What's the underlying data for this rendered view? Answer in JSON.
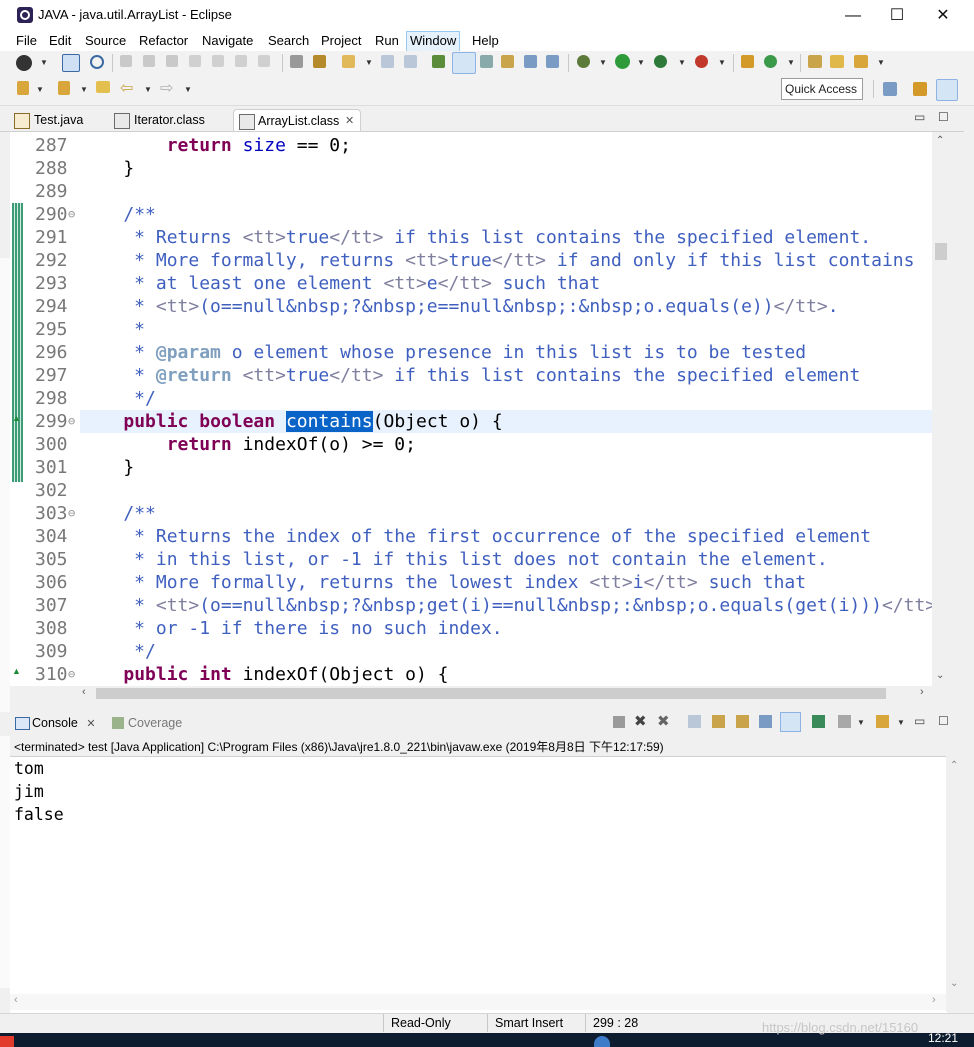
{
  "window": {
    "title": "JAVA - java.util.ArrayList - Eclipse",
    "minimize": "—",
    "maximize": "☐",
    "close": "✕"
  },
  "menu": [
    "File",
    "Edit",
    "Source",
    "Refactor",
    "Navigate",
    "Search",
    "Project",
    "Run",
    "Window",
    "Help"
  ],
  "toolbar": {
    "quick_access": "Quick Access"
  },
  "editor_tabs": [
    {
      "label": "Test.java"
    },
    {
      "label": "Iterator.class"
    },
    {
      "label": "ArrayList.class",
      "active": true,
      "close": "✕"
    }
  ],
  "editor": {
    "lines": [
      {
        "n": "287",
        "code": [
          [
            "        ",
            ""
          ],
          [
            "return",
            "kw"
          ],
          [
            " ",
            ""
          ],
          [
            "size",
            "fld"
          ],
          [
            " == 0;",
            ""
          ]
        ]
      },
      {
        "n": "288",
        "code": [
          [
            "    }",
            ""
          ]
        ]
      },
      {
        "n": "289",
        "code": []
      },
      {
        "n": "290",
        "fold": "⊖",
        "code": [
          [
            "    ",
            ""
          ],
          [
            "/**",
            "cm"
          ]
        ]
      },
      {
        "n": "291",
        "code": [
          [
            "     * Returns ",
            "cm"
          ],
          [
            "<tt>",
            "tag"
          ],
          [
            "true",
            "cm"
          ],
          [
            "</tt>",
            "tag"
          ],
          [
            " if this list contains the specified element.",
            "cm"
          ]
        ]
      },
      {
        "n": "292",
        "code": [
          [
            "     * More formally, returns ",
            "cm"
          ],
          [
            "<tt>",
            "tag"
          ],
          [
            "true",
            "cm"
          ],
          [
            "</tt>",
            "tag"
          ],
          [
            " if and only if this list contains",
            "cm"
          ]
        ]
      },
      {
        "n": "293",
        "code": [
          [
            "     * at least one element ",
            "cm"
          ],
          [
            "<tt>",
            "tag"
          ],
          [
            "e",
            "cm"
          ],
          [
            "</tt>",
            "tag"
          ],
          [
            " such that",
            "cm"
          ]
        ]
      },
      {
        "n": "294",
        "code": [
          [
            "     * ",
            "cm"
          ],
          [
            "<tt>",
            "tag"
          ],
          [
            "(o==null&nbsp;?&nbsp;e==null&nbsp;:&nbsp;o.equals(e))",
            "cm"
          ],
          [
            "</tt>",
            "tag"
          ],
          [
            ".",
            "cm"
          ]
        ]
      },
      {
        "n": "295",
        "code": [
          [
            "     *",
            "cm"
          ]
        ]
      },
      {
        "n": "296",
        "code": [
          [
            "     * ",
            "cm"
          ],
          [
            "@param",
            "jdt"
          ],
          [
            " o element whose presence in this list is to be tested",
            "cm"
          ]
        ]
      },
      {
        "n": "297",
        "code": [
          [
            "     * ",
            "cm"
          ],
          [
            "@return",
            "jdt"
          ],
          [
            " ",
            "cm"
          ],
          [
            "<tt>",
            "tag"
          ],
          [
            "true",
            "cm"
          ],
          [
            "</tt>",
            "tag"
          ],
          [
            " if this list contains the specified element",
            "cm"
          ]
        ]
      },
      {
        "n": "298",
        "code": [
          [
            "     */",
            "cm"
          ]
        ]
      },
      {
        "n": "299",
        "fold": "⊖",
        "code": [
          [
            "    ",
            ""
          ],
          [
            "public",
            "kw"
          ],
          [
            " ",
            ""
          ],
          [
            "boolean",
            "kw"
          ],
          [
            " ",
            ""
          ],
          [
            "contains",
            "sel"
          ],
          [
            "(Object o) {",
            ""
          ]
        ]
      },
      {
        "n": "300",
        "code": [
          [
            "        ",
            ""
          ],
          [
            "return",
            "kw"
          ],
          [
            " indexOf(o) >= 0;",
            ""
          ]
        ]
      },
      {
        "n": "301",
        "code": [
          [
            "    }",
            ""
          ]
        ]
      },
      {
        "n": "302",
        "code": []
      },
      {
        "n": "303",
        "fold": "⊖",
        "code": [
          [
            "    ",
            ""
          ],
          [
            "/**",
            "cm"
          ]
        ]
      },
      {
        "n": "304",
        "code": [
          [
            "     * Returns the index of the first occurrence of the specified element",
            "cm"
          ]
        ]
      },
      {
        "n": "305",
        "code": [
          [
            "     * in this list, or -1 if this list does not contain the element.",
            "cm"
          ]
        ]
      },
      {
        "n": "306",
        "code": [
          [
            "     * More formally, returns the lowest index ",
            "cm"
          ],
          [
            "<tt>",
            "tag"
          ],
          [
            "i",
            "cm"
          ],
          [
            "</tt>",
            "tag"
          ],
          [
            " such that",
            "cm"
          ]
        ]
      },
      {
        "n": "307",
        "code": [
          [
            "     * ",
            "cm"
          ],
          [
            "<tt>",
            "tag"
          ],
          [
            "(o==null&nbsp;?&nbsp;get(i)==null&nbsp;:&nbsp;o.equals(get(i)))",
            "cm"
          ],
          [
            "</tt>",
            "tag"
          ]
        ]
      },
      {
        "n": "308",
        "code": [
          [
            "     * or -1 if there is no such index.",
            "cm"
          ]
        ]
      },
      {
        "n": "309",
        "code": [
          [
            "     */",
            "cm"
          ]
        ]
      },
      {
        "n": "310",
        "fold": "⊖",
        "code": [
          [
            "    ",
            ""
          ],
          [
            "public",
            "kw"
          ],
          [
            " ",
            ""
          ],
          [
            "int",
            "kw"
          ],
          [
            " indexOf(Object o) {",
            ""
          ]
        ]
      }
    ]
  },
  "console": {
    "tab_label": "Console",
    "tab_close": "✕",
    "coverage_label": "Coverage",
    "status": "<terminated> test [Java Application] C:\\Program Files (x86)\\Java\\jre1.8.0_221\\bin\\javaw.exe (2019年8月8日 下午12:17:59)",
    "output": [
      "tom",
      "jim",
      "false"
    ]
  },
  "statusbar": {
    "mode": "Read-Only",
    "insert": "Smart Insert",
    "position": "299 : 28"
  },
  "taskbar": {
    "clock": "12:21",
    "watermark": "https://blog.csdn.net/15160"
  },
  "colors": {
    "keyword": "#7f0055",
    "field": "#0000c0",
    "comment": "#3f5fbf",
    "html_tag": "#7f7f9f",
    "selection": "#0a64c8",
    "current_line": "#e8f2fe"
  }
}
